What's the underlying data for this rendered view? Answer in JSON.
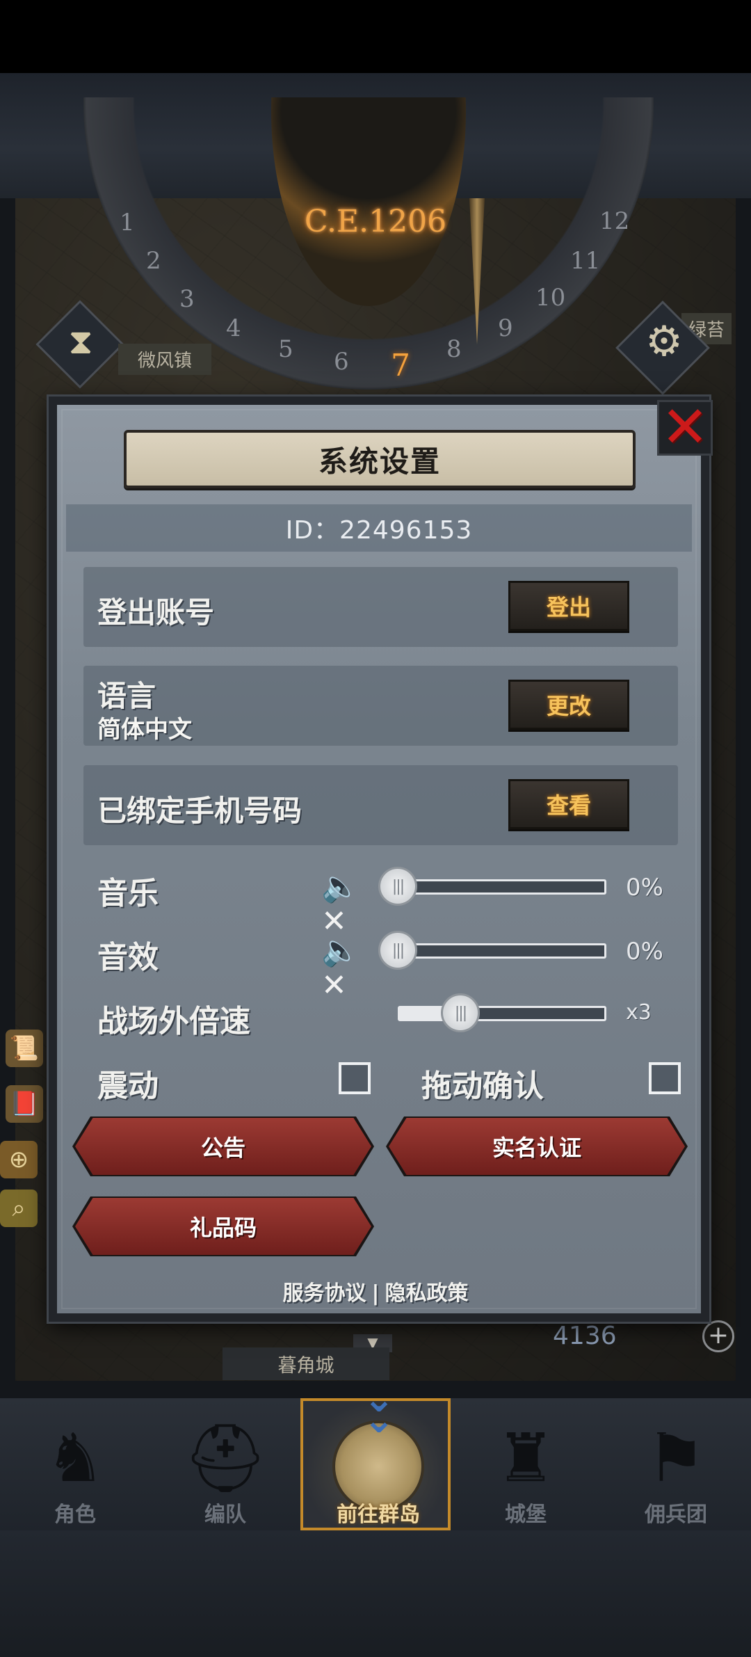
{
  "map": {
    "era": "C.E.1206",
    "dial_numbers": [
      "1",
      "2",
      "3",
      "4",
      "5",
      "6",
      "7",
      "8",
      "9",
      "10",
      "11",
      "12"
    ],
    "active_number": "7",
    "town_left": "微风镇",
    "town_right": "绿苔",
    "bottom_city": "暮角城",
    "currency_value": "4136"
  },
  "dialog": {
    "title": "系统设置",
    "player_id": "ID：22496153",
    "logout": {
      "label": "登出账号",
      "button": "登出"
    },
    "language": {
      "label": "语言",
      "value": "简体中文",
      "button": "更改"
    },
    "phone": {
      "label": "已绑定手机号码",
      "button": "查看"
    },
    "music": {
      "label": "音乐",
      "value_text": "0%",
      "level": 0
    },
    "sfx": {
      "label": "音效",
      "value_text": "0%",
      "level": 0
    },
    "speed": {
      "label": "战场外倍速",
      "value_text": "x3",
      "level": 0.3
    },
    "vibration": {
      "label": "震动",
      "checked": false
    },
    "drag_confirm": {
      "label": "拖动确认",
      "checked": false
    },
    "buttons": {
      "announcement": "公告",
      "real_name": "实名认证",
      "gift_code": "礼品码"
    },
    "footer": {
      "terms": "服务协议",
      "separator": "|",
      "privacy": "隐私政策"
    }
  },
  "nav": {
    "items": [
      {
        "label": "角色",
        "icon": "knight-icon"
      },
      {
        "label": "编队",
        "icon": "helmet-icon"
      },
      {
        "label": "前往群岛",
        "icon": "globe-icon",
        "active": true
      },
      {
        "label": "城堡",
        "icon": "castle-icon"
      },
      {
        "label": "佣兵团",
        "icon": "banner-icon"
      }
    ]
  },
  "colors": {
    "accent_orange": "#f4a13c",
    "close_red": "#cc1a1a",
    "button_text_gold": "#f7c35c",
    "red_button": "#8a2e29",
    "active_nav_border": "#c48a2a"
  }
}
